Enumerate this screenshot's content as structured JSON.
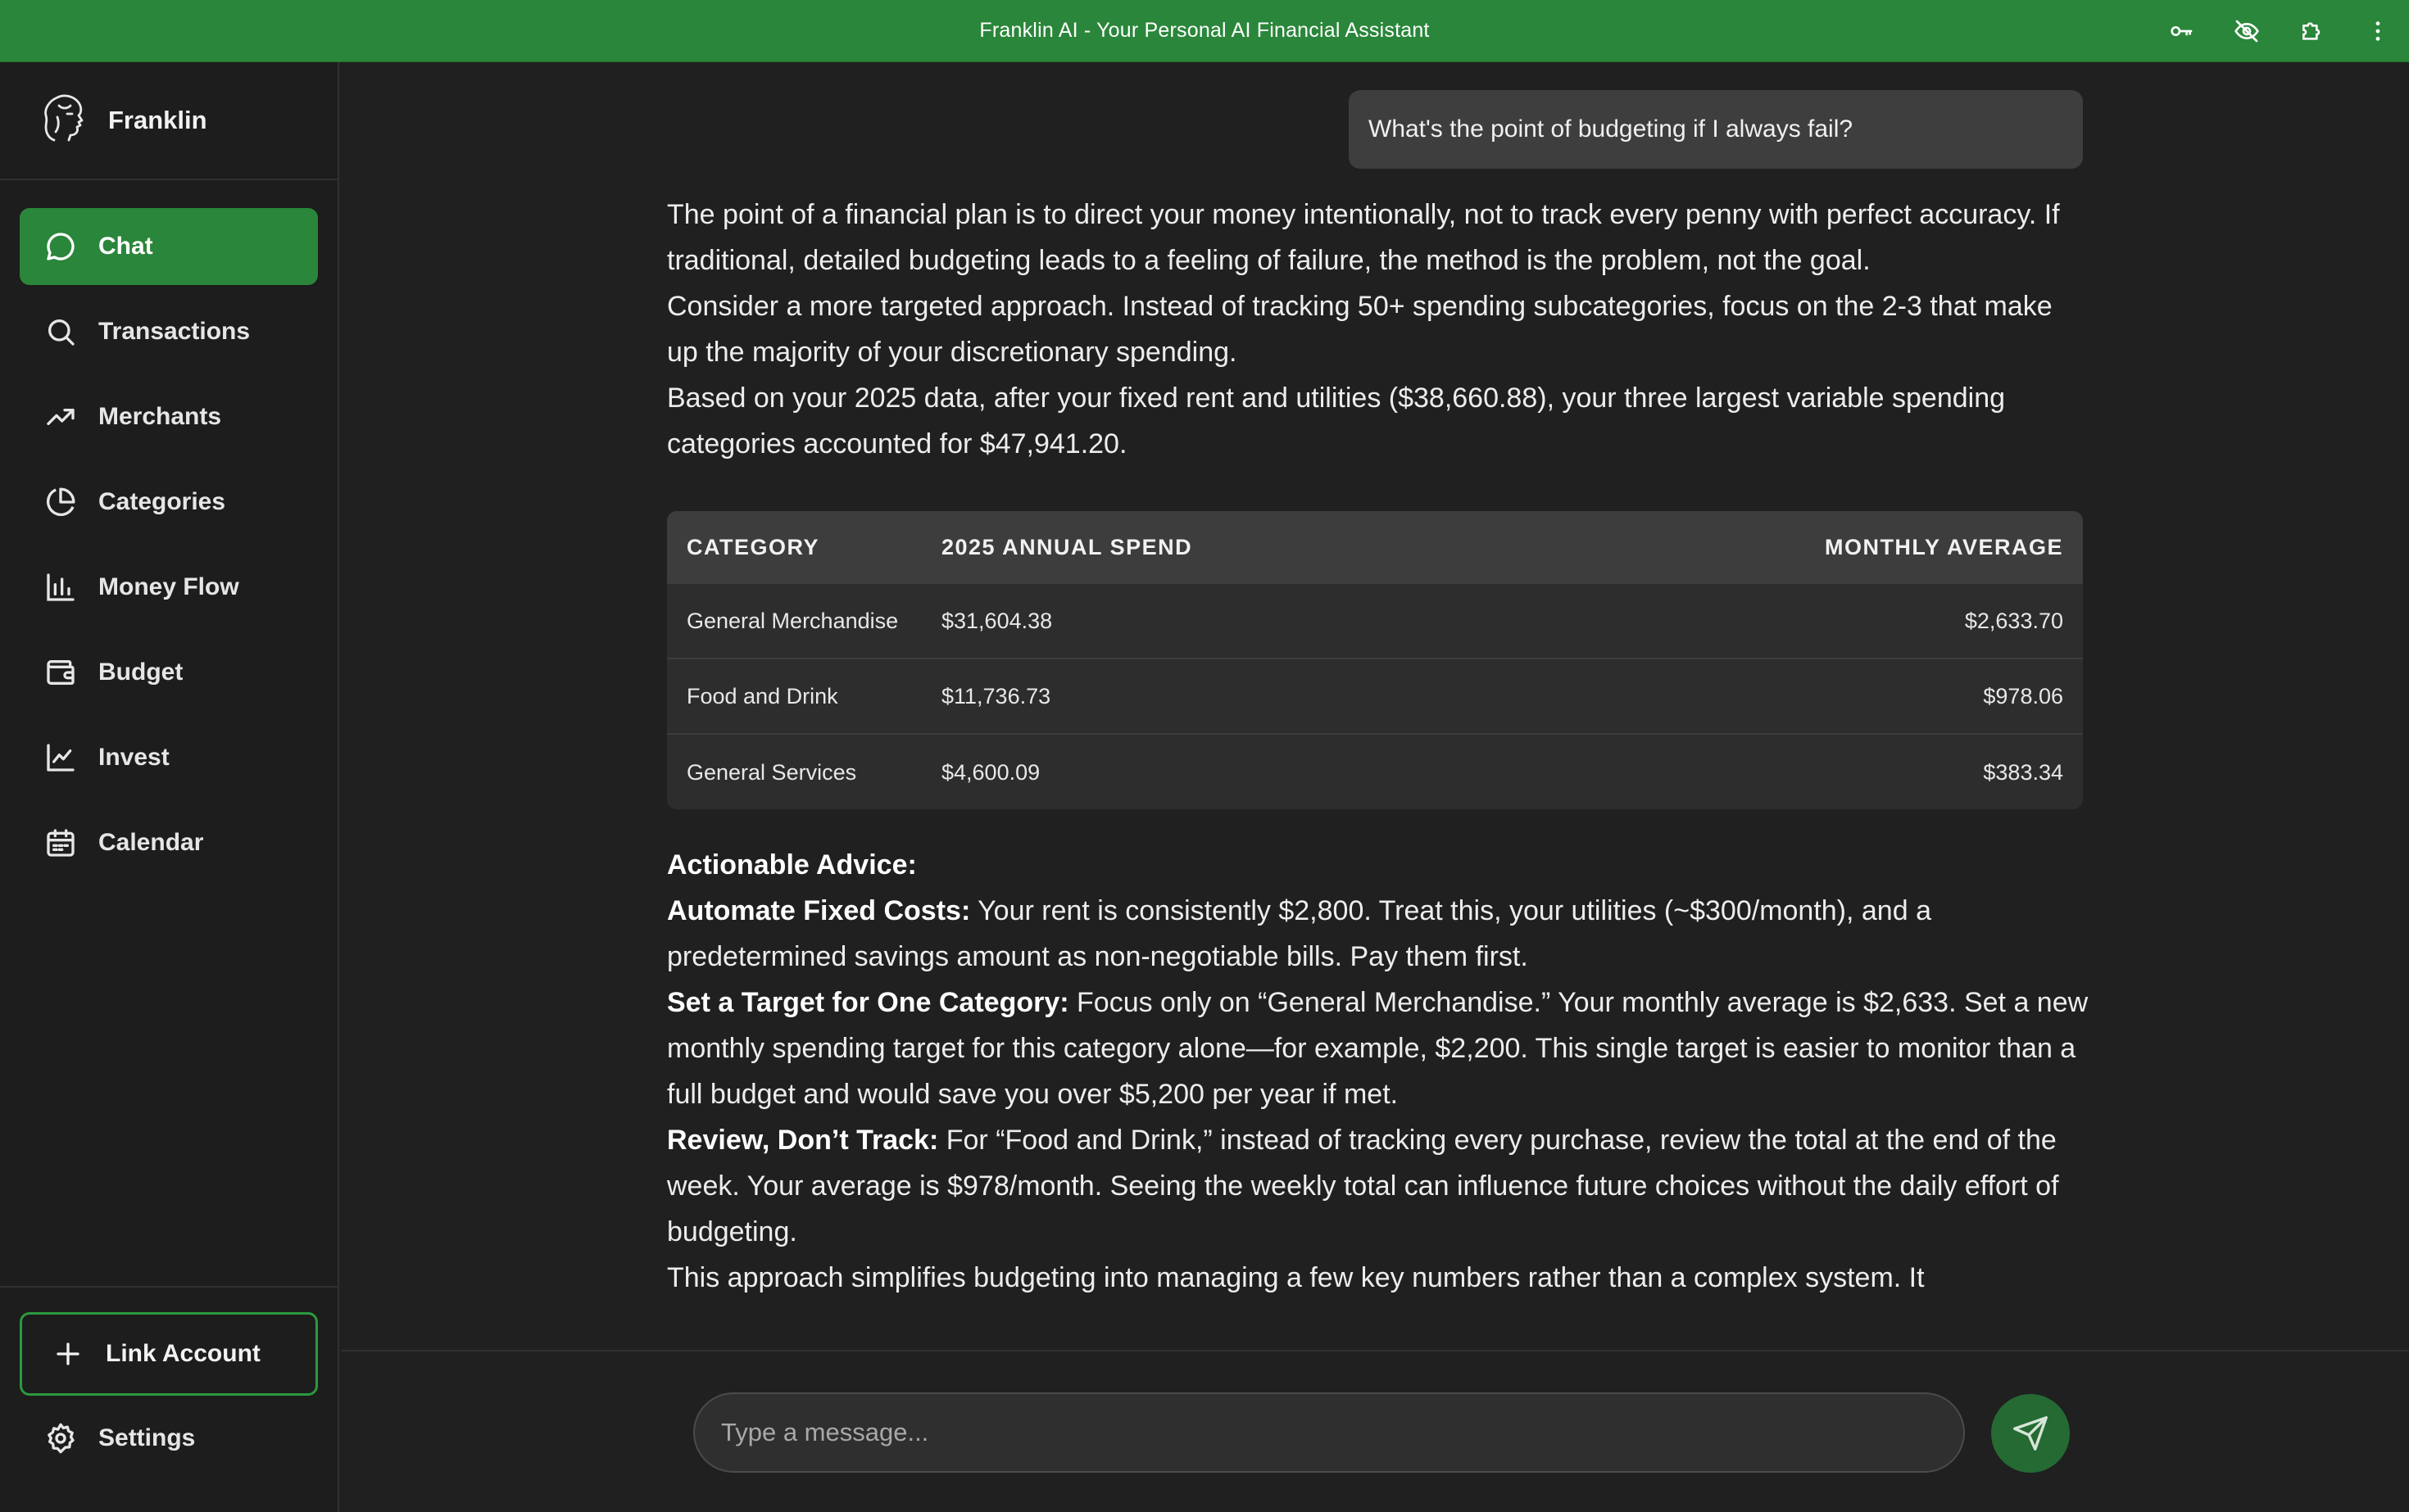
{
  "window": {
    "title": "Franklin AI - Your Personal AI Financial Assistant",
    "icons": [
      "key-icon",
      "eye-off-icon",
      "puzzle-icon",
      "more-vertical-icon"
    ]
  },
  "sidebar": {
    "brand": "Franklin",
    "items": [
      {
        "label": "Chat",
        "icon": "chat-bubble-icon",
        "active": true
      },
      {
        "label": "Transactions",
        "icon": "search-icon"
      },
      {
        "label": "Merchants",
        "icon": "trending-up-icon"
      },
      {
        "label": "Categories",
        "icon": "pie-chart-icon"
      },
      {
        "label": "Money Flow",
        "icon": "bar-chart-icon"
      },
      {
        "label": "Budget",
        "icon": "wallet-icon"
      },
      {
        "label": "Invest",
        "icon": "line-chart-icon"
      },
      {
        "label": "Calendar",
        "icon": "calendar-icon"
      }
    ],
    "link_account": "Link Account",
    "settings": "Settings"
  },
  "chat": {
    "user_message": "What's the point of budgeting if I always fail?",
    "reply": {
      "p1": "The point of a financial plan is to direct your money intentionally, not to track every penny with perfect accuracy. If traditional, detailed budgeting leads to a feeling of failure, the method is the problem, not the goal.",
      "p2": "Consider a more targeted approach. Instead of tracking 50+ spending subcategories, focus on the 2-3 that make up the majority of your discretionary spending.",
      "p3": "Based on your 2025 data, after your fixed rent and utilities ($38,660.88), your three largest variable spending categories accounted for $47,941.20.",
      "table": {
        "headers": [
          "CATEGORY",
          "2025 ANNUAL SPEND",
          "MONTHLY AVERAGE"
        ],
        "rows": [
          [
            "General Merchandise",
            "$31,604.38",
            "$2,633.70"
          ],
          [
            "Food and Drink",
            "$11,736.73",
            "$978.06"
          ],
          [
            "General Services",
            "$4,600.09",
            "$383.34"
          ]
        ]
      },
      "advice_heading": "Actionable Advice:",
      "advice": [
        {
          "title": "Automate Fixed Costs:",
          "text": " Your rent is consistently $2,800. Treat this, your utilities (~$300/month), and a predetermined savings amount as non-negotiable bills. Pay them first."
        },
        {
          "title": "Set a Target for One Category:",
          "text": " Focus only on “General Merchandise.” Your monthly average is $2,633. Set a new monthly spending target for this category alone—for example, $2,200. This single target is easier to monitor than a full budget and would save you over $5,200 per year if met."
        },
        {
          "title": "Review, Don’t Track:",
          "text": " For “Food and Drink,” instead of tracking every purchase, review the total at the end of the week. Your average is $978/month. Seeing the weekly total can influence future choices without the daily effort of budgeting."
        }
      ],
      "closing": "This approach simplifies budgeting into managing a few key numbers rather than a complex system. It"
    }
  },
  "composer": {
    "placeholder": "Type a message...",
    "send_icon": "send-icon"
  },
  "colors": {
    "accent": "#2a863a",
    "background": "#1f201f",
    "sidebar": "#1c1d1c"
  }
}
